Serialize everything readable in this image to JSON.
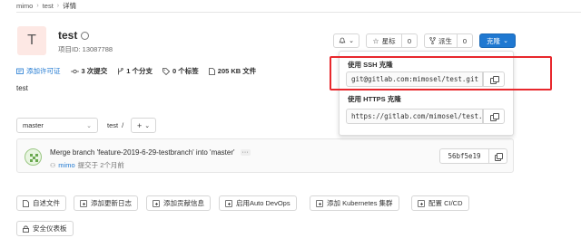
{
  "breadcrumb": {
    "root": "mimo",
    "project": "test",
    "current": "详情"
  },
  "project": {
    "avatar_letter": "T",
    "name": "test",
    "id_text": "项目ID: 13087788",
    "description": "test"
  },
  "header_actions": {
    "notification_caret": "⌄",
    "star_label": "星标",
    "star_count": "0",
    "fork_label": "派生",
    "fork_count": "0",
    "clone_label": "克隆"
  },
  "stats": {
    "add_license": "添加许可证",
    "commits": "3 次提交",
    "branches": "1 个分支",
    "tags": "0 个标签",
    "files": "205 KB 文件"
  },
  "controls": {
    "branch": "master",
    "path": "test",
    "separator": "/",
    "add": "+"
  },
  "commit": {
    "message": "Merge branch 'feature-2019-6-29-testbranch' into 'master'",
    "more": "···",
    "author": "mimo",
    "meta": "提交于 2个月前",
    "sha": "56bf5e19"
  },
  "clone": {
    "ssh_label": "使用 SSH 克隆",
    "ssh_url": "git@gitlab.com:mimosel/test.git",
    "https_label": "使用 HTTPS 克隆",
    "https_url": "https://gitlab.com/mimosel/test.git"
  },
  "quick_actions": [
    {
      "label": "自述文件"
    },
    {
      "label": "添加更新日志"
    },
    {
      "label": "添加贡献信息"
    },
    {
      "label": "启用Auto DevOps"
    },
    {
      "label": "添加 Kubernetes 集群"
    },
    {
      "label": "配置 CI/CD"
    },
    {
      "label": "安全仪表板"
    }
  ],
  "colors": {
    "primary": "#1f78d1",
    "highlight": "#e8282d",
    "avatar_bg": "#fde8e4"
  }
}
